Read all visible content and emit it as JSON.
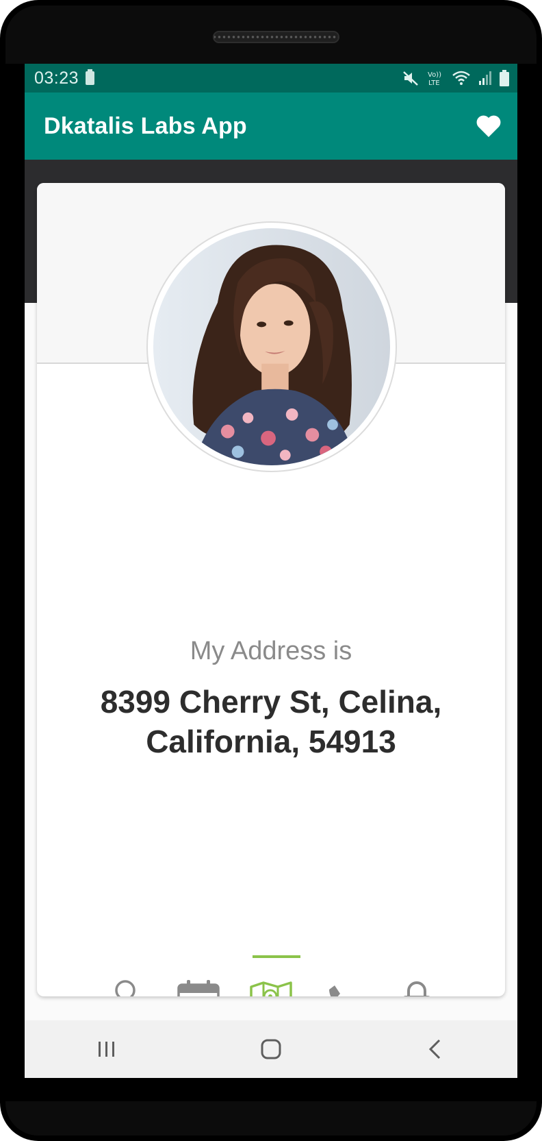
{
  "status_bar": {
    "time": "03:23",
    "icons": [
      "battery-saver-icon",
      "mute-icon",
      "volte-icon",
      "wifi-icon",
      "signal-icon",
      "battery-icon"
    ]
  },
  "app_bar": {
    "title": "Dkatalis Labs App",
    "action_icon": "heart-icon"
  },
  "profile": {
    "photo": "profile-photo"
  },
  "content": {
    "label": "My Address is",
    "value": "8399 Cherry St, Celina, California, 54913"
  },
  "tabs": {
    "items": [
      {
        "icon": "user-icon"
      },
      {
        "icon": "calendar-icon"
      },
      {
        "icon": "map-icon"
      },
      {
        "icon": "phone-icon"
      },
      {
        "icon": "lock-icon"
      }
    ],
    "active_index": 2
  },
  "colors": {
    "status_bar": "#00695c",
    "app_bar": "#00897b",
    "accent": "#8bc34a",
    "icon_inactive": "#8a8a8a",
    "header_band": "#2c2c2e"
  },
  "nav_bar": {
    "items": [
      "recents-icon",
      "home-icon",
      "back-icon"
    ]
  }
}
